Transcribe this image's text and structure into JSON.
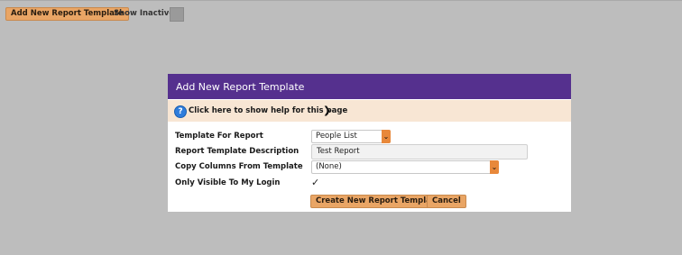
{
  "toolbar": {
    "add_label": "Add New Report Template",
    "show_inactive_label": "Show Inactive",
    "show_inactive_checked": false
  },
  "dialog": {
    "title": "Add New Report Template",
    "help_text": "Click here to show help for this page",
    "colors": {
      "header": "#55308e",
      "help_bar": "#f8e6d4",
      "button": "#e9a565"
    },
    "fields": {
      "template_for_report": {
        "label": "Template For Report",
        "value": "People List"
      },
      "description": {
        "label": "Report Template Description",
        "value": "Test Report"
      },
      "copy_columns": {
        "label": "Copy Columns From Template",
        "value": "(None)"
      },
      "only_visible": {
        "label": "Only Visible To My Login",
        "checked": true
      }
    },
    "buttons": {
      "create": "Create New Report Template",
      "cancel": "Cancel"
    }
  }
}
